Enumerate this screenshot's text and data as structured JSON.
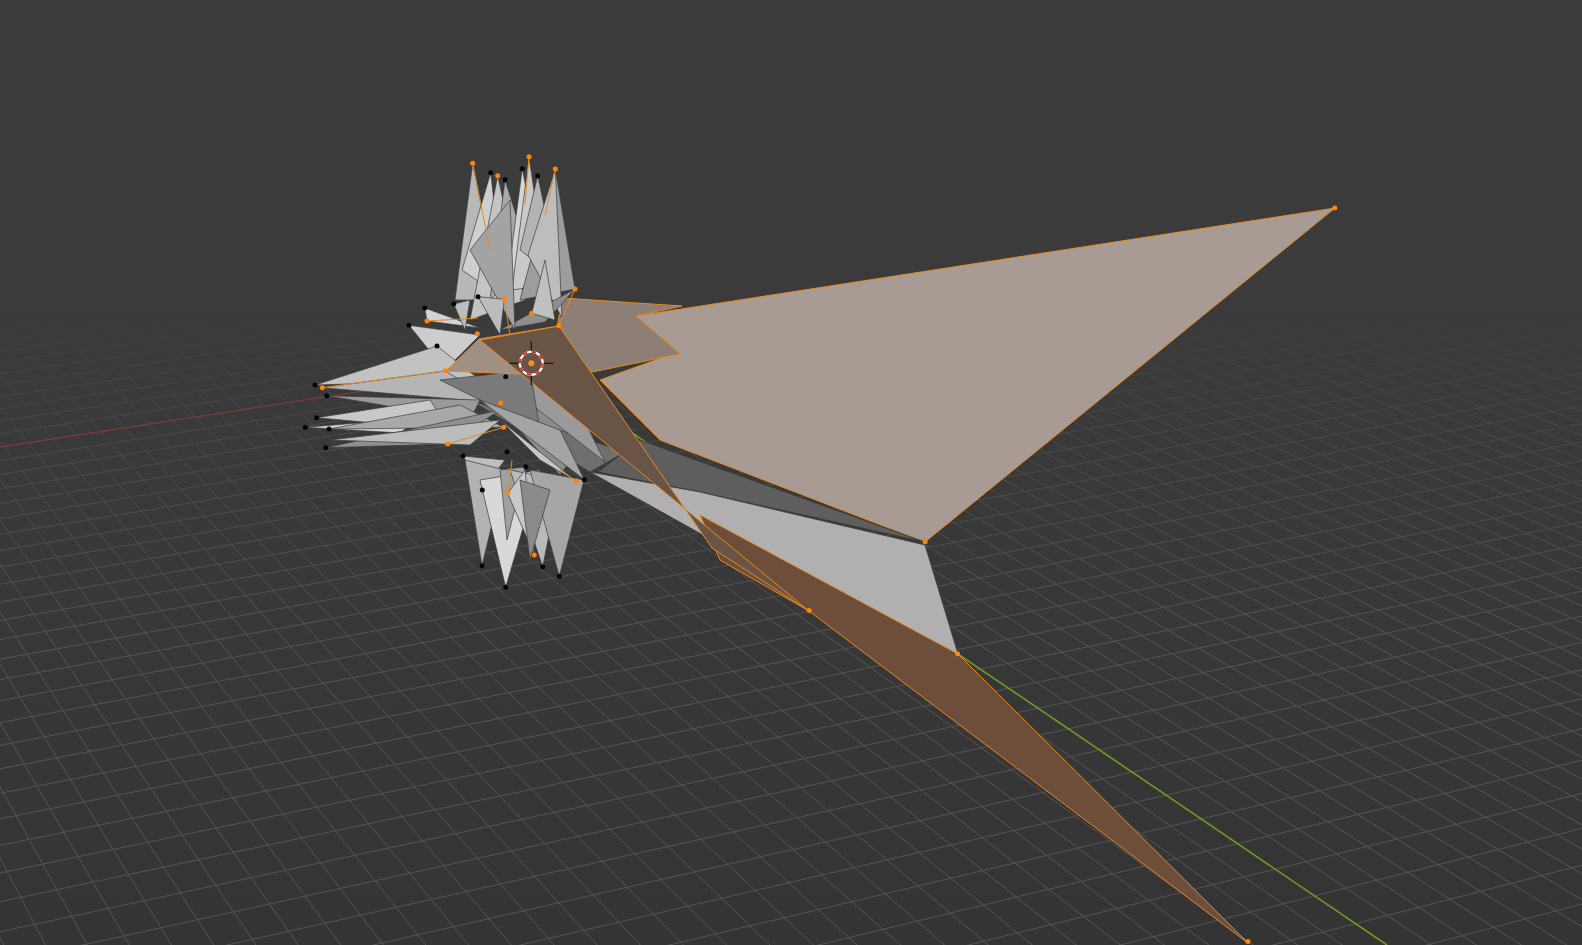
{
  "viewport": {
    "faces": [
      {
        "selected": true
      },
      {
        "selected": true
      },
      {
        "selected": false
      },
      {
        "selected": false
      },
      {
        "selected": true
      },
      {
        "selected": true
      },
      {
        "selected": true
      }
    ],
    "vertices": [
      {
        "selected": true
      },
      {
        "selected": true
      },
      {
        "selected": false
      },
      {
        "selected": true
      },
      {
        "selected": false
      },
      {
        "selected": true
      },
      {
        "selected": false
      },
      {
        "selected": false
      },
      {
        "selected": true
      },
      {
        "selected": true
      },
      {
        "selected": false
      },
      {
        "selected": true
      },
      {
        "selected": false
      },
      {
        "selected": false
      },
      {
        "selected": true
      },
      {
        "selected": true
      },
      {
        "selected": false
      },
      {
        "selected": true
      },
      {
        "selected": true
      },
      {
        "selected": false
      },
      {
        "selected": true
      },
      {
        "selected": false
      },
      {
        "selected": false
      },
      {
        "selected": true
      },
      {
        "selected": false
      },
      {
        "selected": true
      },
      {
        "selected": false
      },
      {
        "selected": false
      },
      {
        "selected": true
      },
      {
        "selected": false
      },
      {
        "selected": true
      },
      {
        "selected": false
      },
      {
        "selected": false
      },
      {
        "selected": false
      },
      {
        "selected": false
      },
      {
        "selected": false
      },
      {
        "selected": true
      },
      {
        "selected": false
      },
      {
        "selected": true
      },
      {
        "selected": true
      },
      {
        "selected": true
      },
      {
        "selected": false
      },
      {
        "selected": false
      },
      {
        "selected": false
      },
      {
        "selected": false
      },
      {
        "selected": true
      },
      {
        "selected": true
      },
      {
        "selected": true
      }
    ]
  }
}
